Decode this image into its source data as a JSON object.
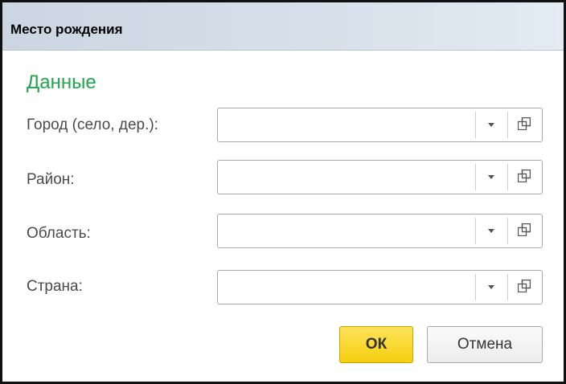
{
  "window": {
    "title": "Место рождения"
  },
  "section": {
    "title": "Данные"
  },
  "fields": [
    {
      "label": "Город (село, дер.):",
      "value": "",
      "dropdown_icon": "chevron-down-icon",
      "open_icon": "open-window-icon"
    },
    {
      "label": "Район:",
      "value": "",
      "dropdown_icon": "chevron-down-icon",
      "open_icon": "open-window-icon"
    },
    {
      "label": "Область:",
      "value": "",
      "dropdown_icon": "chevron-down-icon",
      "open_icon": "open-window-icon"
    },
    {
      "label": "Страна:",
      "value": "",
      "dropdown_icon": "chevron-down-icon",
      "open_icon": "open-window-icon"
    }
  ],
  "buttons": {
    "ok_label": "ОК",
    "cancel_label": "Отмена"
  },
  "colors": {
    "section_title": "#22a54e",
    "ok_button": "#f6cf10",
    "title_bar": "#d6e0ea"
  }
}
